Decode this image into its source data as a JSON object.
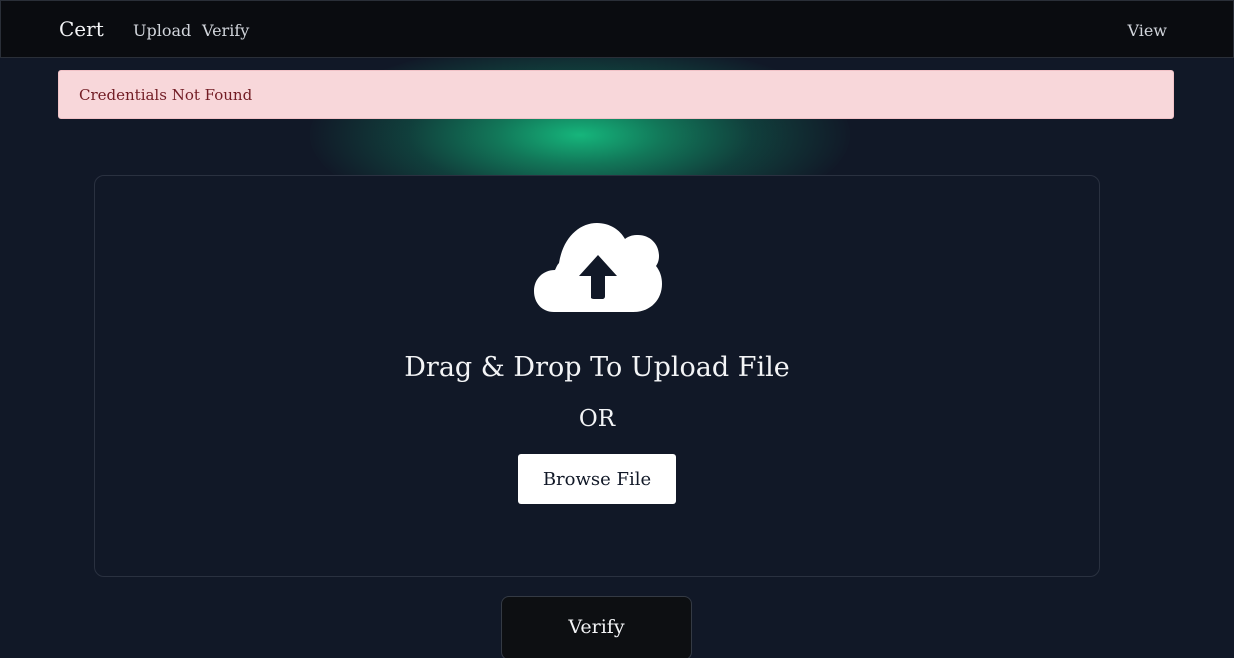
{
  "navbar": {
    "brand": "Cert",
    "links": {
      "upload": "Upload",
      "verify": "Verify",
      "view": "View"
    }
  },
  "alert": {
    "message": "Credentials Not Found",
    "status_color": "#f8d7da"
  },
  "dropzone": {
    "icon": "cloud-upload-icon",
    "heading": "Drag & Drop To Upload File",
    "separator": "OR",
    "browse_label": "Browse File"
  },
  "actions": {
    "verify_label": "Verify"
  },
  "colors": {
    "background": "#111827",
    "navbar": "#0a0c10",
    "accent_glow": "#16be80"
  }
}
